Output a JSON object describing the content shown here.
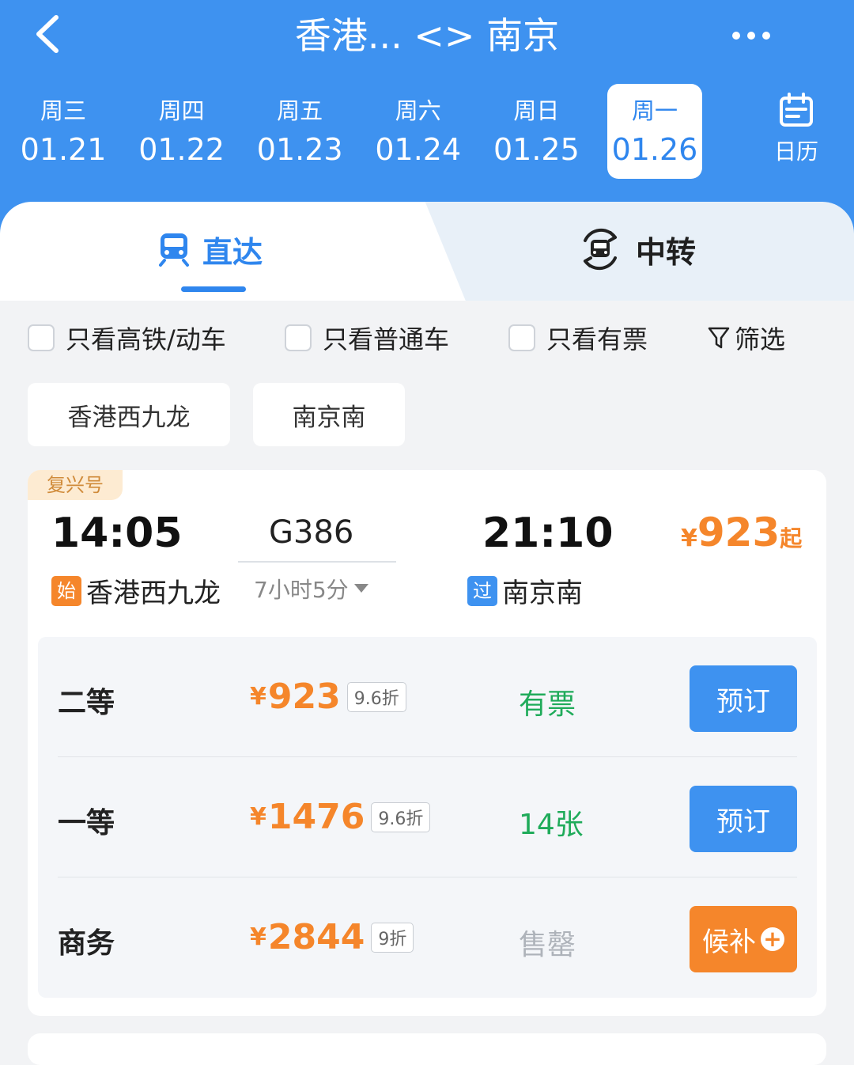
{
  "header": {
    "title": "香港... <> 南京",
    "dates": [
      {
        "weekday": "周三",
        "date": "01.21",
        "selected": false
      },
      {
        "weekday": "周四",
        "date": "01.22",
        "selected": false
      },
      {
        "weekday": "周五",
        "date": "01.23",
        "selected": false
      },
      {
        "weekday": "周六",
        "date": "01.24",
        "selected": false
      },
      {
        "weekday": "周日",
        "date": "01.25",
        "selected": false
      },
      {
        "weekday": "周一",
        "date": "01.26",
        "selected": true
      }
    ],
    "calendar_label": "日历"
  },
  "tabs": {
    "direct": "直达",
    "transfer": "中转",
    "active": "direct"
  },
  "filters": {
    "high_speed": "只看高铁/动车",
    "normal": "只看普通车",
    "available": "只看有票",
    "filter": "筛选"
  },
  "stations": {
    "from": "香港西九龙",
    "to": "南京南"
  },
  "train": {
    "badge": "复兴号",
    "departure_time": "14:05",
    "arrival_time": "21:10",
    "number": "G386",
    "duration": "7小时5分",
    "departure_tag": "始",
    "departure_station": "香港西九龙",
    "arrival_tag": "过",
    "arrival_station": "南京南",
    "min_price": {
      "currency": "¥",
      "amount": "923",
      "suffix": "起"
    },
    "seats": [
      {
        "name": "二等",
        "currency": "¥",
        "price": "923",
        "discount": "9.6折",
        "availability": "有票",
        "action": "预订"
      },
      {
        "name": "一等",
        "currency": "¥",
        "price": "1476",
        "discount": "9.6折",
        "availability": "14张",
        "action": "预订"
      },
      {
        "name": "商务",
        "currency": "¥",
        "price": "2844",
        "discount": "9折",
        "availability": "售罄",
        "action": "候补"
      }
    ]
  },
  "colors": {
    "brand_blue": "#3e92f0",
    "orange": "#f5862b",
    "green": "#1fab5a"
  }
}
